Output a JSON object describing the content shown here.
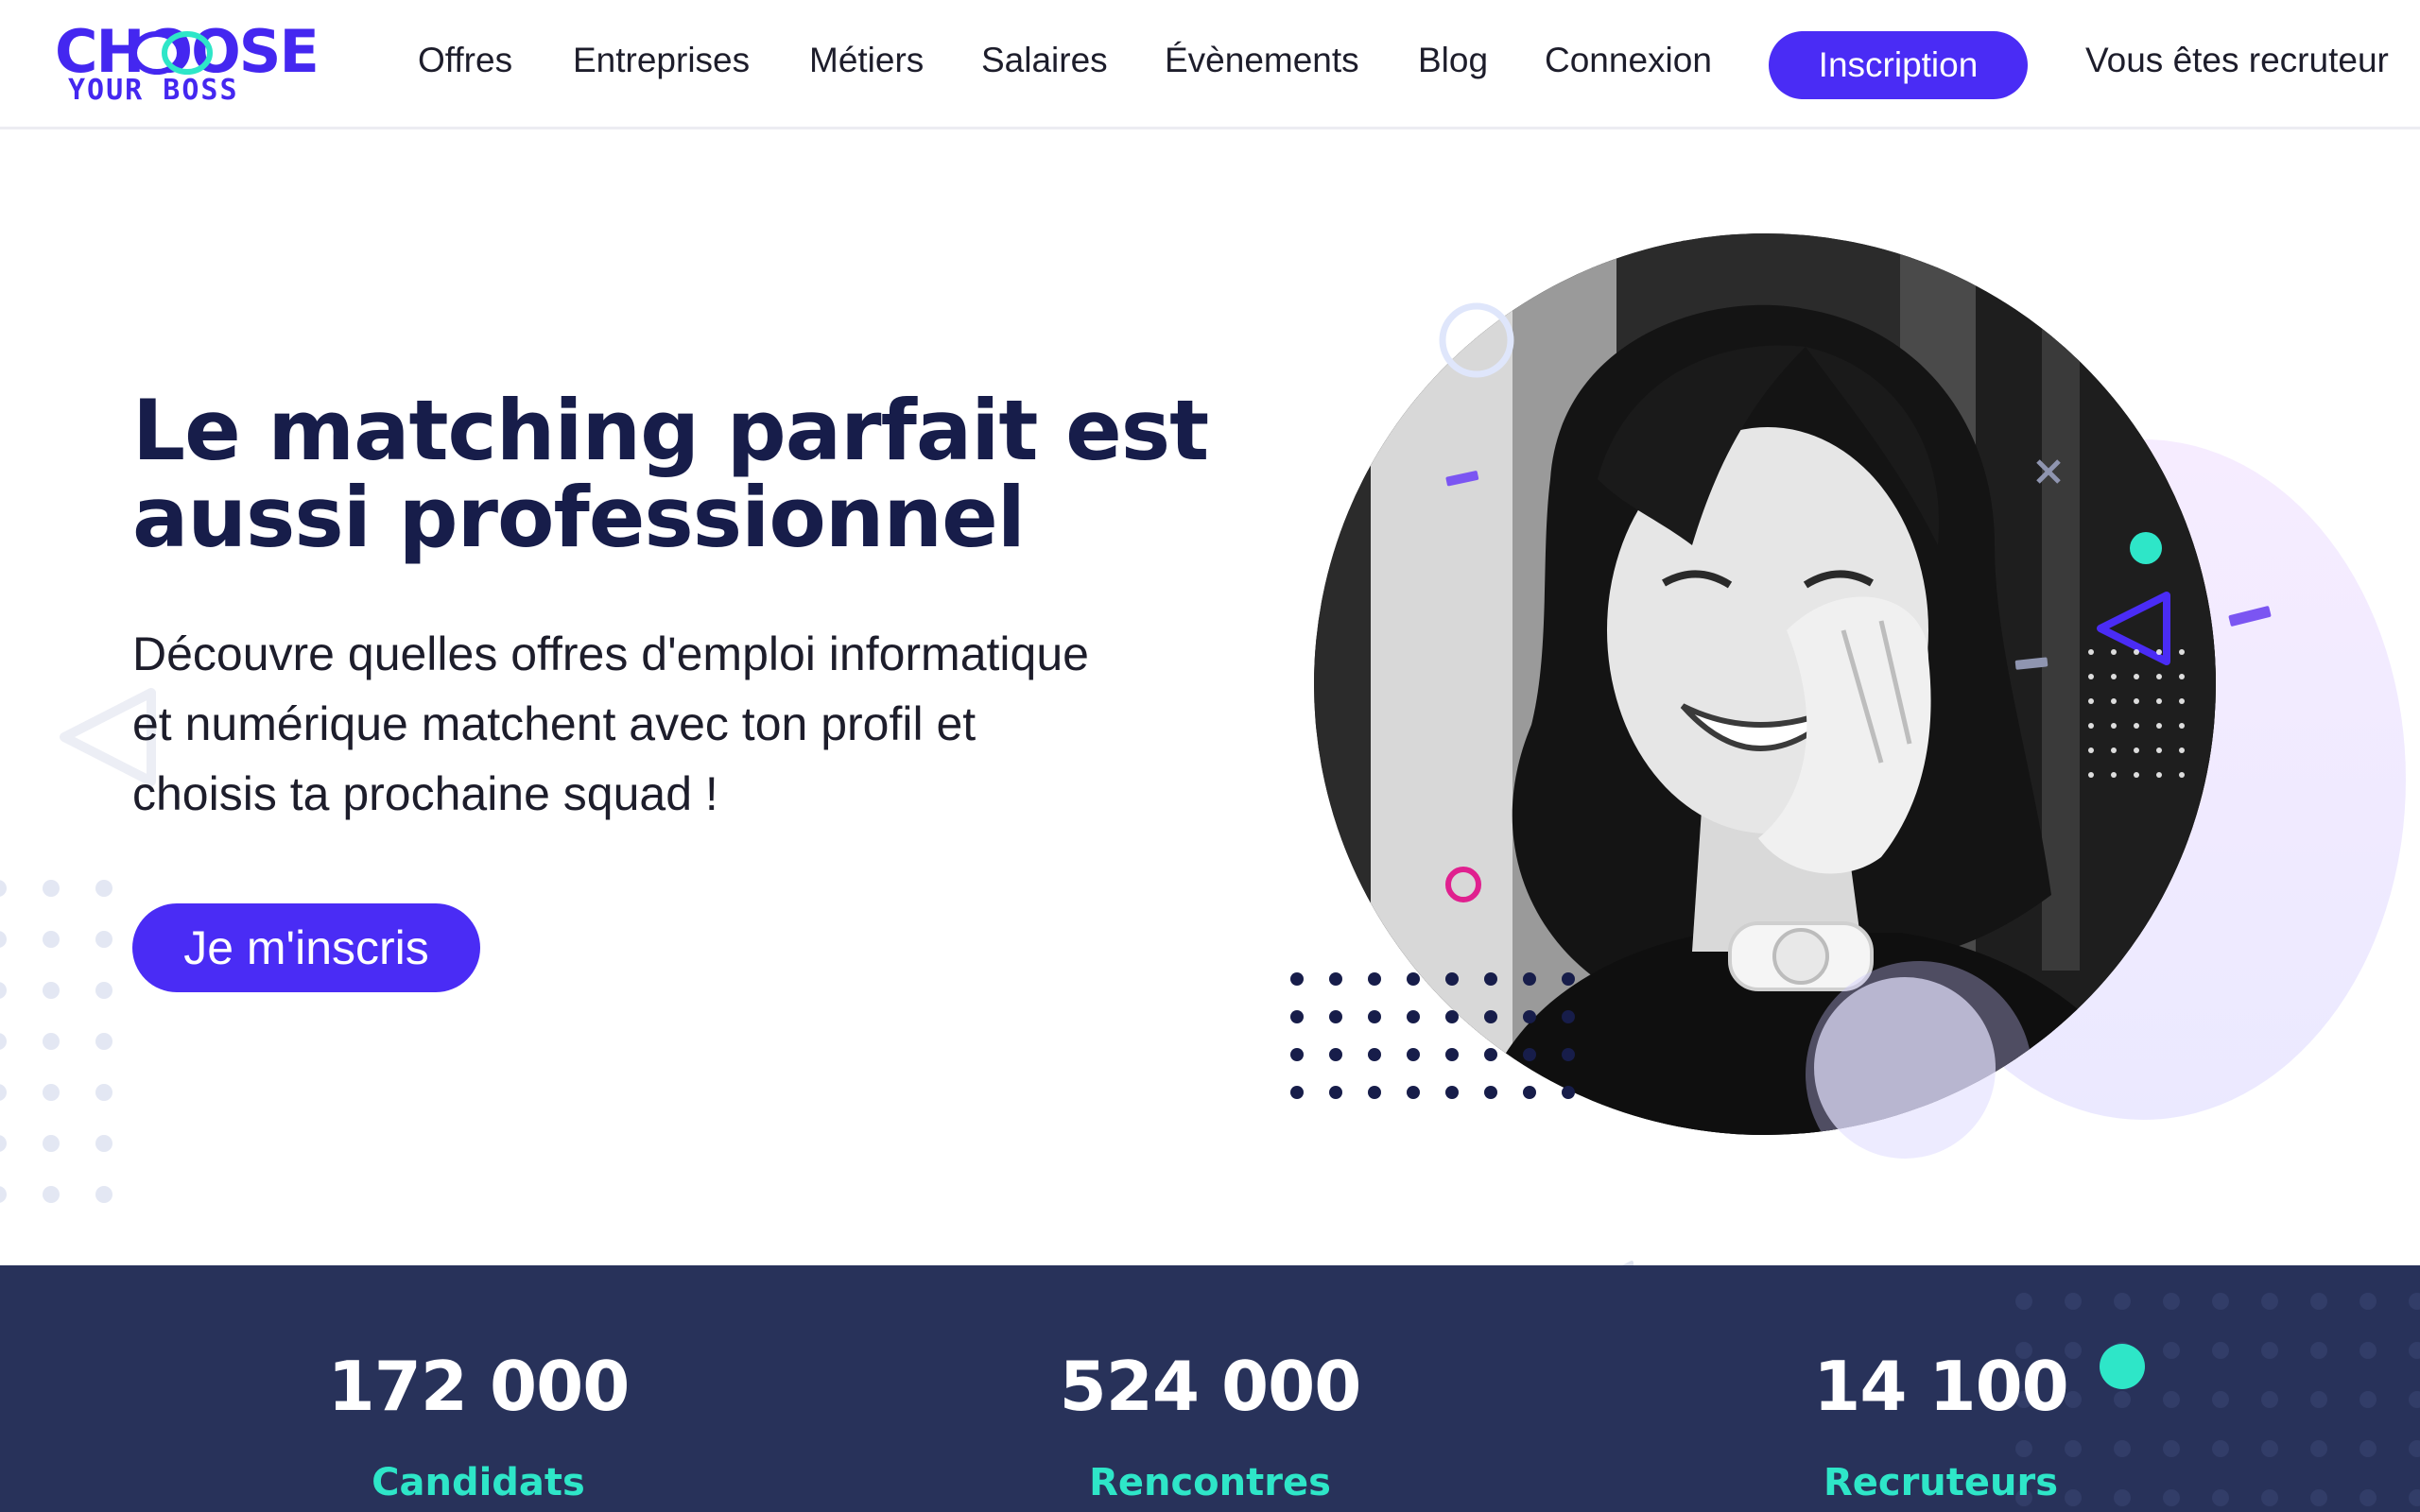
{
  "brand": {
    "logo_top": "CHOOSE",
    "logo_bottom": "YOUR BOSS",
    "accent_color": "#4a2cf5",
    "navy_color": "#171d4a",
    "teal_color": "#2ee6c8"
  },
  "nav": {
    "items": [
      "Offres",
      "Entreprises",
      "Métiers",
      "Salaires",
      "Évènements",
      "Blog",
      "Connexion"
    ],
    "signup_label": "Inscription",
    "recruiter_label": "Vous êtes recruteur"
  },
  "hero": {
    "title_line1": "Le matching parfait est",
    "title_line2": "aussi professionnel",
    "subtitle_line1": "Découvre quelles offres d'emploi informatique",
    "subtitle_line2": "et numérique matchent avec ton profil et",
    "subtitle_line3": "choisis ta prochaine squad !",
    "cta_label": "Je m'inscris"
  },
  "stats": [
    {
      "value": "172 000",
      "label": "Candidats"
    },
    {
      "value": "524 000",
      "label": "Rencontres"
    },
    {
      "value": "14 100",
      "label": "Recruteurs"
    }
  ]
}
